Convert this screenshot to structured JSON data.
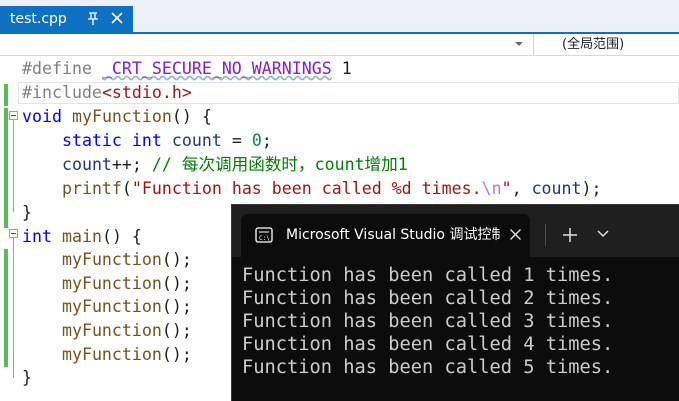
{
  "tab": {
    "title": "test.cpp",
    "pin_icon": "pin-icon",
    "close_icon": "close-icon"
  },
  "nav_bar": {
    "scope_label": "(全局范围)",
    "dropdown_icon": "chevron-down-icon"
  },
  "editor": {
    "lines": [
      {
        "pp": "#define ",
        "macro": "_CRT_SECURE_NO_WARNINGS",
        "rest": " 1"
      },
      {
        "pp": "#include",
        "header": "<stdio.h>"
      },
      {
        "kw": "void",
        "name": "myFunction",
        "rest": "() {"
      },
      {
        "indent": "    ",
        "kw1": "static",
        "kw2": "int",
        "var": "count",
        "op": " = ",
        "num": "0",
        "end": ";"
      },
      {
        "indent": "    ",
        "var": "count",
        "op": "++; ",
        "comment": "// 每次调用函数时，count增加1"
      },
      {
        "indent": "    ",
        "fn": "printf",
        "open": "(",
        "str_a": "\"Function has been called %d times.",
        "esc": "\\n",
        "str_b": "\"",
        "sep": ", ",
        "var": "count",
        "close": ");"
      },
      {
        "text": "}"
      },
      {
        "kw": "int",
        "name": "main",
        "rest": "() {"
      },
      {
        "indent": "    ",
        "fn": "myFunction",
        "rest": "();"
      },
      {
        "indent": "    ",
        "fn": "myFunction",
        "rest": "();"
      },
      {
        "indent": "    ",
        "fn": "myFunction",
        "rest": "();"
      },
      {
        "indent": "    ",
        "fn": "myFunction",
        "rest": "();"
      },
      {
        "indent": "    ",
        "fn": "myFunction",
        "rest": "();"
      },
      {
        "text": "}"
      }
    ]
  },
  "console": {
    "title": "Microsoft Visual Studio 调试控制台",
    "app_icon": "terminal-icon",
    "close_icon": "close-icon",
    "new_tab_icon": "plus-icon",
    "dropdown_icon": "chevron-down-icon",
    "output": [
      "Function has been called 1 times.",
      "Function has been called 2 times.",
      "Function has been called 3 times.",
      "Function has been called 4 times.",
      "Function has been called 5 times."
    ]
  },
  "colors": {
    "tab_active": "#0e70c0",
    "keyword": "#0000ff",
    "function": "#74531f",
    "variable": "#1f377f",
    "string": "#a31515",
    "comment": "#008000",
    "macro": "#8a1bd6",
    "console_bg": "#0c0c0c",
    "console_text": "#cccccc"
  }
}
